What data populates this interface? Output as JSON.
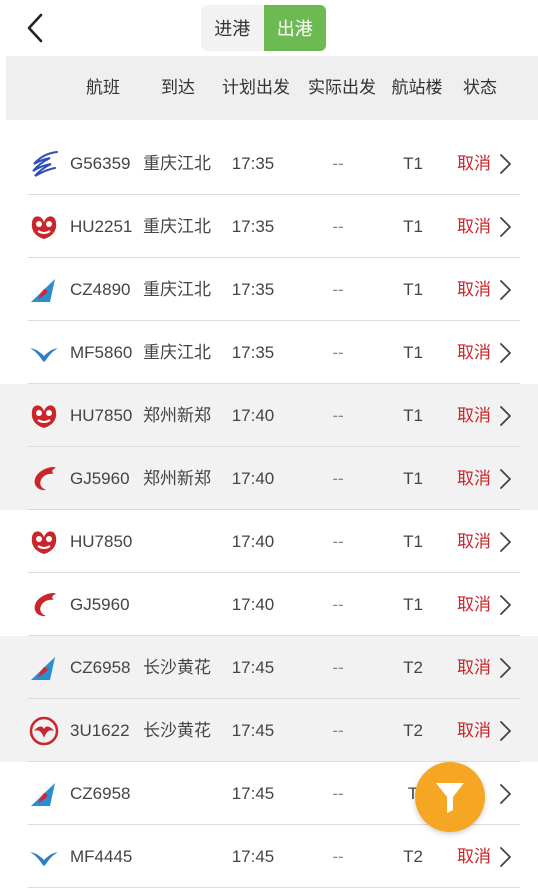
{
  "tabs": {
    "arrival": "进港",
    "departure": "出港",
    "active": "departure"
  },
  "columns": {
    "flight": "航班",
    "destination": "到达",
    "scheduled": "计划出发",
    "actual": "实际出发",
    "terminal": "航站楼",
    "status": "状态"
  },
  "flights": [
    {
      "airline_icon": "bird-wing-logo-blue",
      "color": "#2d4fb5",
      "flight": "G56359",
      "destination": "重庆江北",
      "scheduled": "17:35",
      "actual": "--",
      "terminal": "T1",
      "status": "取消"
    },
    {
      "airline_icon": "hainan-airlines-logo",
      "color": "#c9252b",
      "flight": "HU2251",
      "destination": "重庆江北",
      "scheduled": "17:35",
      "actual": "--",
      "terminal": "T1",
      "status": "取消"
    },
    {
      "airline_icon": "china-southern-logo",
      "color": "#2a8fd0",
      "flight": "CZ4890",
      "destination": "重庆江北",
      "scheduled": "17:35",
      "actual": "--",
      "terminal": "T1",
      "status": "取消"
    },
    {
      "airline_icon": "xiamen-airlines-logo",
      "color": "#2c7dc4",
      "flight": "MF5860",
      "destination": "重庆江北",
      "scheduled": "17:35",
      "actual": "--",
      "terminal": "T1",
      "status": "取消"
    },
    {
      "airline_icon": "hainan-airlines-logo",
      "color": "#c9252b",
      "flight": "HU7850",
      "destination": "郑州新郑",
      "scheduled": "17:40",
      "actual": "--",
      "terminal": "T1",
      "status": "取消"
    },
    {
      "airline_icon": "dragon-logo-red",
      "color": "#c9252b",
      "flight": "GJ5960",
      "destination": "郑州新郑",
      "scheduled": "17:40",
      "actual": "--",
      "terminal": "T1",
      "status": "取消"
    },
    {
      "airline_icon": "hainan-airlines-logo",
      "color": "#c9252b",
      "flight": "HU7850",
      "destination": "",
      "scheduled": "17:40",
      "actual": "--",
      "terminal": "T1",
      "status": "取消"
    },
    {
      "airline_icon": "dragon-logo-red",
      "color": "#c9252b",
      "flight": "GJ5960",
      "destination": "",
      "scheduled": "17:40",
      "actual": "--",
      "terminal": "T1",
      "status": "取消"
    },
    {
      "airline_icon": "china-southern-logo",
      "color": "#2a8fd0",
      "flight": "CZ6958",
      "destination": "长沙黄花",
      "scheduled": "17:45",
      "actual": "--",
      "terminal": "T2",
      "status": "取消"
    },
    {
      "airline_icon": "sichuan-airlines-logo",
      "color": "#c9252b",
      "flight": "3U1622",
      "destination": "长沙黄花",
      "scheduled": "17:45",
      "actual": "--",
      "terminal": "T2",
      "status": "取消"
    },
    {
      "airline_icon": "china-southern-logo",
      "color": "#2a8fd0",
      "flight": "CZ6958",
      "destination": "",
      "scheduled": "17:45",
      "actual": "--",
      "terminal": "T",
      "status": "消"
    },
    {
      "airline_icon": "xiamen-airlines-logo",
      "color": "#2c7dc4",
      "flight": "MF4445",
      "destination": "",
      "scheduled": "17:45",
      "actual": "--",
      "terminal": "T2",
      "status": "取消"
    }
  ],
  "colors": {
    "accent": "#6dba52",
    "cancel": "#c9252b",
    "fab": "#f5a623"
  }
}
